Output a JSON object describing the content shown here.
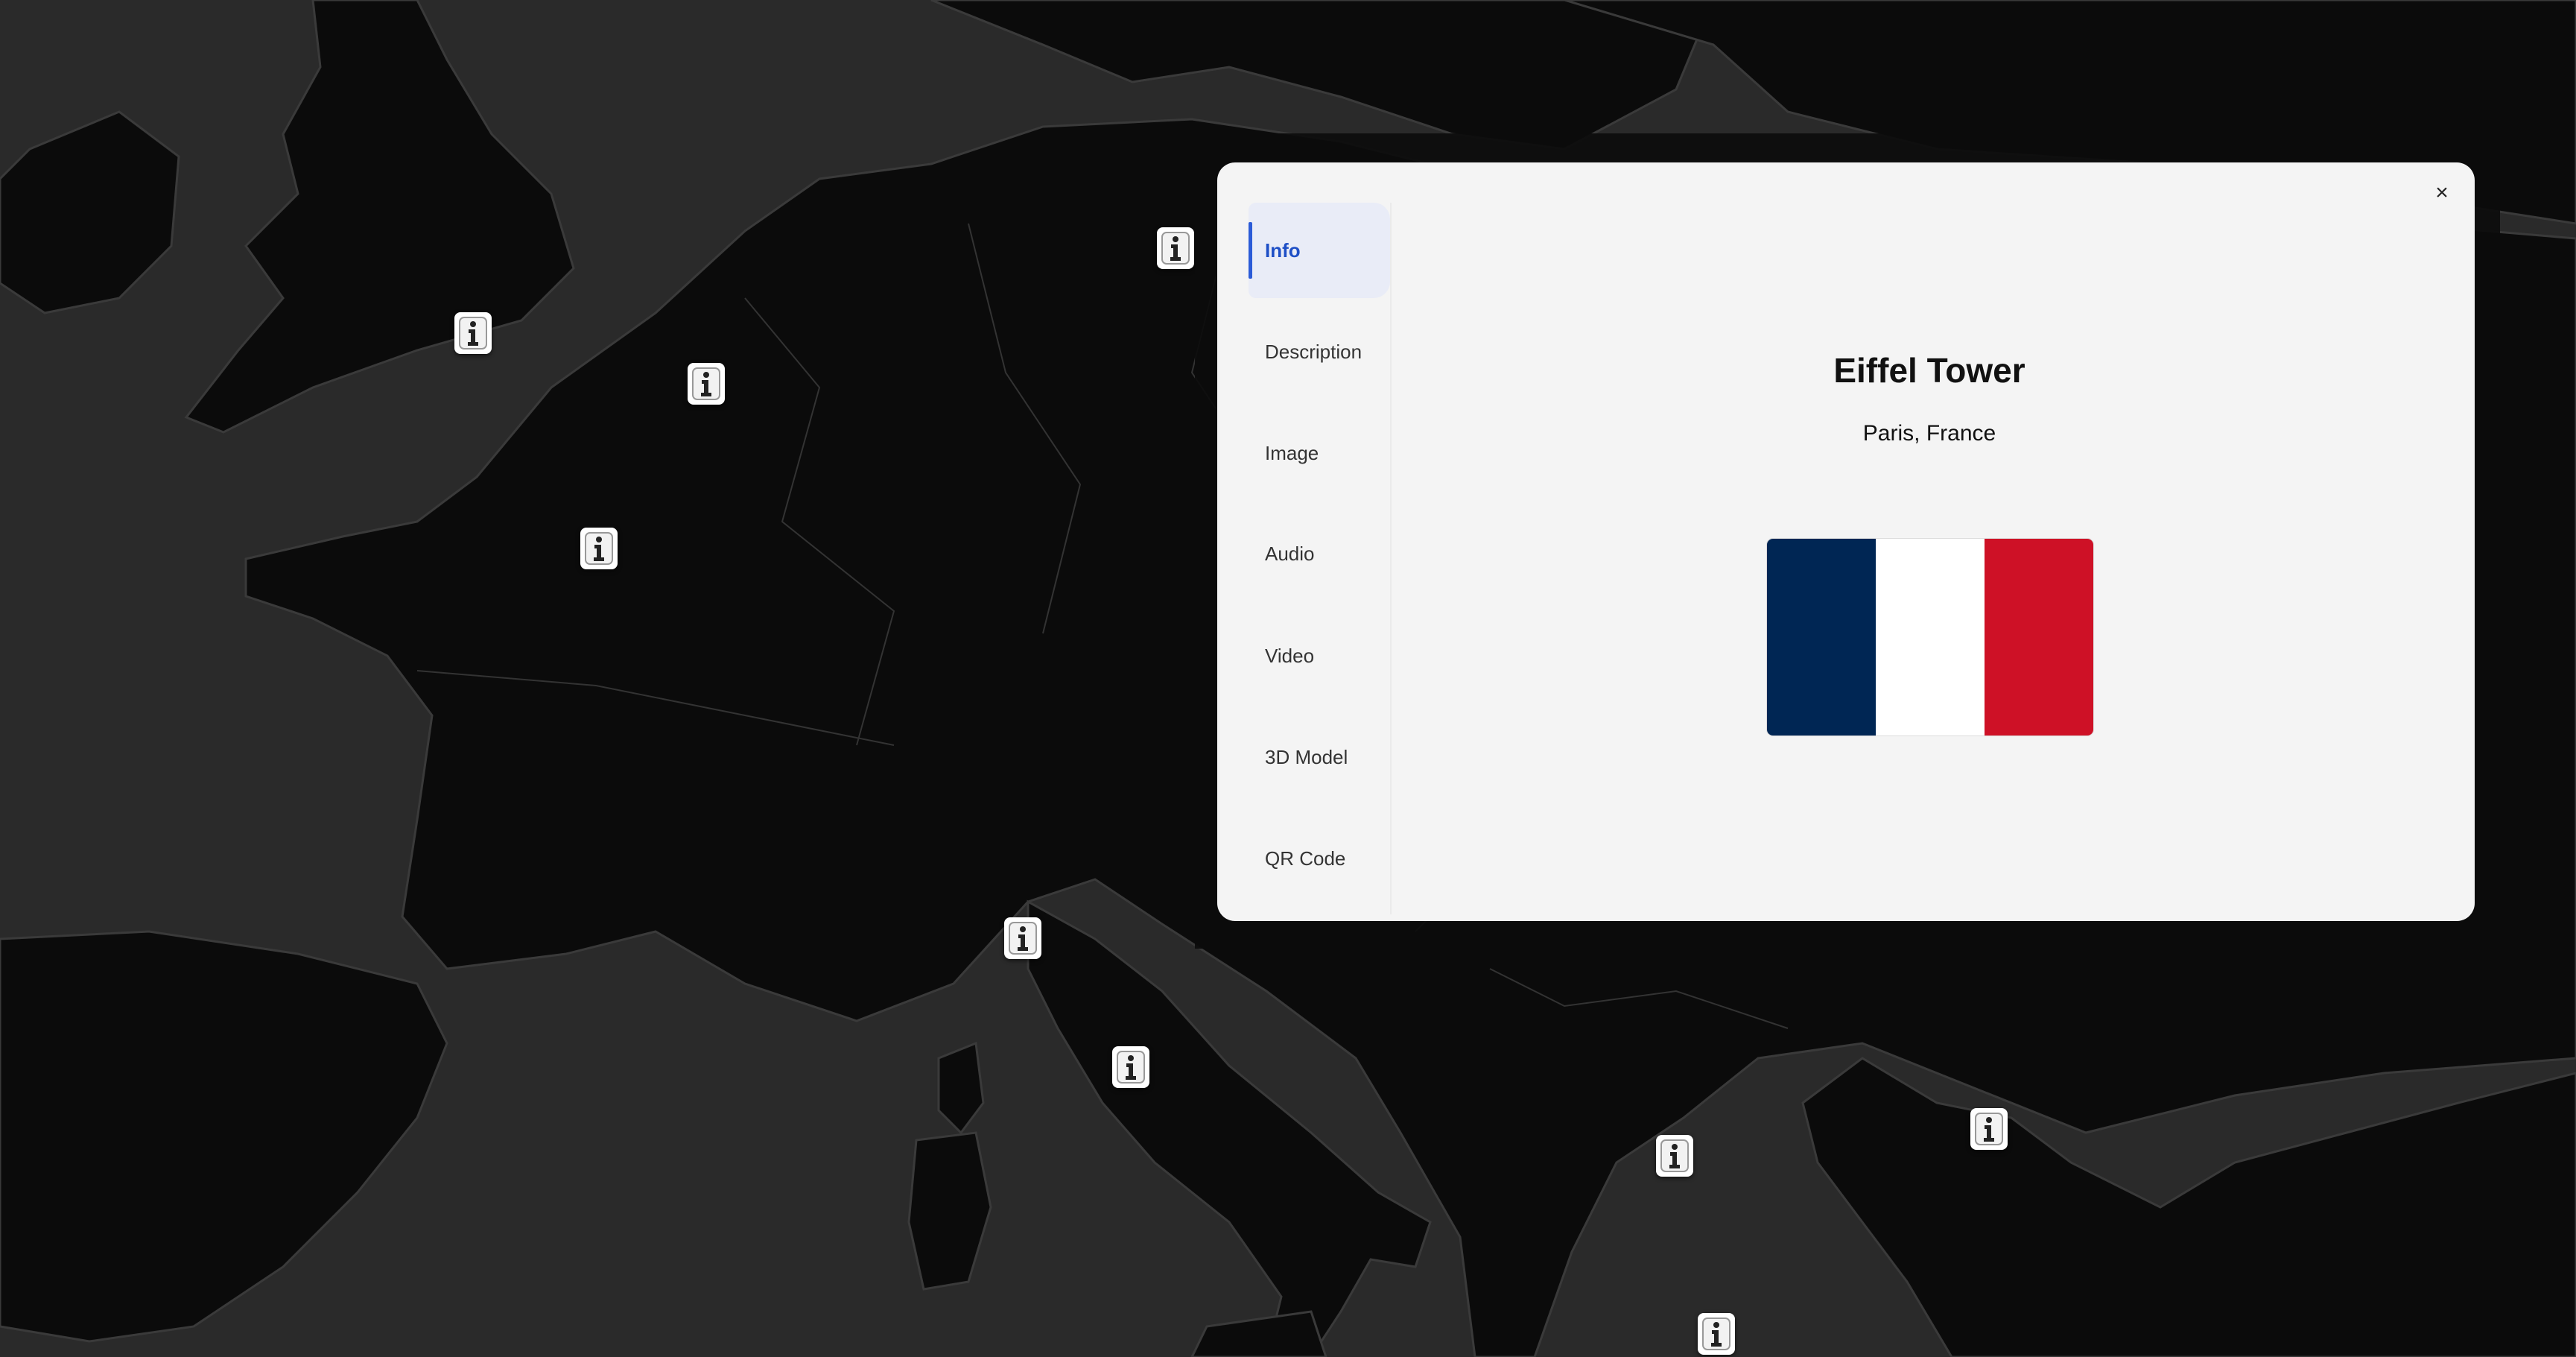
{
  "map": {
    "land_color": "#0b0b0b",
    "sea_color": "#2a2a2a",
    "border_color": "#3a3a3a",
    "marker_icon": "info-icon",
    "marker_count": 11
  },
  "popup": {
    "close_label": "×",
    "close_icon": "close-icon",
    "tabs": [
      {
        "label": "Info",
        "active": true
      },
      {
        "label": "Description",
        "active": false
      },
      {
        "label": "Image",
        "active": false
      },
      {
        "label": "Audio",
        "active": false
      },
      {
        "label": "Video",
        "active": false
      },
      {
        "label": "3D Model",
        "active": false
      },
      {
        "label": "QR Code",
        "active": false
      }
    ],
    "info": {
      "title": "Eiffel Tower",
      "location": "Paris, France",
      "flag": {
        "country": "France",
        "colors": [
          "#002654",
          "#ffffff",
          "#ce1126"
        ]
      }
    }
  }
}
